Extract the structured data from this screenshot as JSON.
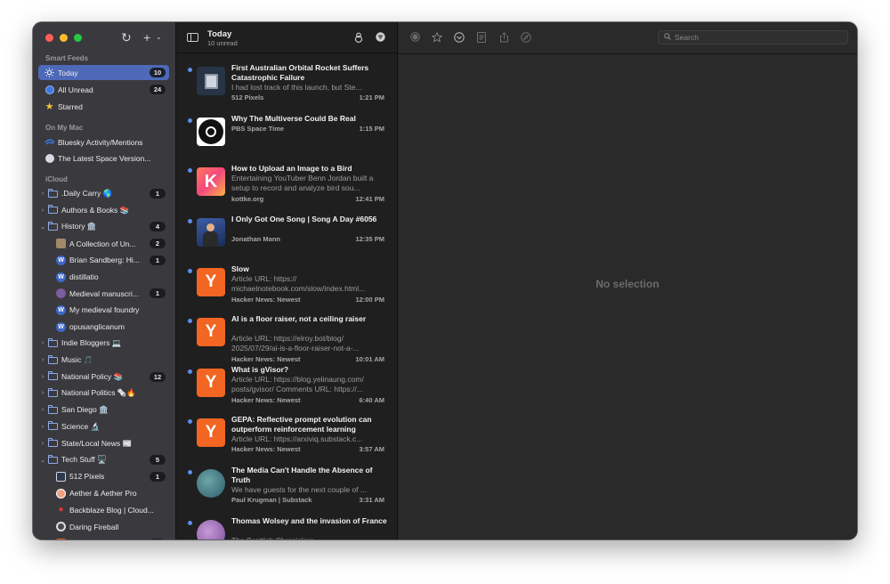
{
  "sidebar": {
    "sections": {
      "smart_feeds": "Smart Feeds",
      "on_my_mac": "On My Mac",
      "icloud": "iCloud"
    },
    "smart_feeds": [
      {
        "label": "Today",
        "count": "10",
        "icon": "sun-icon"
      },
      {
        "label": "All Unread",
        "count": "24",
        "icon": "unread-circle-icon"
      },
      {
        "label": "Starred",
        "count": "",
        "icon": "star-icon"
      }
    ],
    "on_my_mac": [
      {
        "label": "Bluesky Activity/Mentions",
        "icon": "bluesky-icon"
      },
      {
        "label": "The Latest Space Version...",
        "icon": "space-icon"
      }
    ],
    "icloud": [
      {
        "label": ".Daily Carry 🌎",
        "count": "1",
        "type": "folder",
        "expanded": false
      },
      {
        "label": "Authors & Books 📚",
        "count": "",
        "type": "folder",
        "expanded": false
      },
      {
        "label": "History 🏛️",
        "count": "4",
        "type": "folder",
        "expanded": true
      },
      {
        "label": "A Collection of Un...",
        "count": "2",
        "type": "feed"
      },
      {
        "label": "Brian Sandberg: Hi...",
        "count": "1",
        "type": "feed"
      },
      {
        "label": "distillatio",
        "count": "",
        "type": "feed"
      },
      {
        "label": "Medieval manuscri...",
        "count": "1",
        "type": "feed"
      },
      {
        "label": "My medieval foundry",
        "count": "",
        "type": "feed"
      },
      {
        "label": "opusanglicanum",
        "count": "",
        "type": "feed"
      },
      {
        "label": "Indie Bloggers 💻",
        "count": "",
        "type": "folder",
        "expanded": false
      },
      {
        "label": "Music 🎵",
        "count": "",
        "type": "folder",
        "expanded": false
      },
      {
        "label": "National Policy 📚",
        "count": "12",
        "type": "folder",
        "expanded": false
      },
      {
        "label": "National Politics 🗞️🔥",
        "count": "",
        "type": "folder",
        "expanded": false
      },
      {
        "label": "San Diego 🏛️",
        "count": "",
        "type": "folder",
        "expanded": false
      },
      {
        "label": "Science 🔬",
        "count": "",
        "type": "folder",
        "expanded": false
      },
      {
        "label": "State/Local News 📰",
        "count": "",
        "type": "folder",
        "expanded": false
      },
      {
        "label": "Tech Stuff 🖥️",
        "count": "5",
        "type": "folder",
        "expanded": true
      },
      {
        "label": "512 Pixels",
        "count": "1",
        "type": "feed"
      },
      {
        "label": "Aether & Aether Pro",
        "count": "",
        "type": "feed"
      },
      {
        "label": "Backblaze Blog | Cloud...",
        "count": "",
        "type": "feed"
      },
      {
        "label": "Daring Fireball",
        "count": "",
        "type": "feed"
      },
      {
        "label": "Hacker News: Newest",
        "count": "1",
        "type": "feed"
      }
    ]
  },
  "list": {
    "title": "Today",
    "subtitle": "10 unread",
    "articles": [
      {
        "title": "First Australian Orbital Rocket Suffers Catastrophic Failure",
        "summary": "I had lost track of this launch, but Ste...",
        "source": "512 Pixels",
        "time": "1:21 PM"
      },
      {
        "title": "Why The Multiverse Could Be Real",
        "summary": "",
        "source": "PBS Space Time",
        "time": "1:15 PM"
      },
      {
        "title": "How to Upload an Image to a Bird",
        "summary": "Entertaining YouTuber Benn Jordan built a setup to record and analyze bird sou...",
        "source": "kottke.org",
        "time": "12:41 PM"
      },
      {
        "title": "I Only Got One Song | Song A Day #6056",
        "summary": "",
        "source": "Jonathan Mann",
        "time": "12:35 PM"
      },
      {
        "title": "Slow",
        "summary": "Article URL: https:// michaelnotebook.com/slow/index.html...",
        "source": "Hacker News: Newest",
        "time": "12:00 PM"
      },
      {
        "title": "AI is a floor raiser, not a ceiling raiser",
        "summary": "Article URL: https://elroy.bot/blog/ 2025/07/29/ai-is-a-floor-raiser-not-a-...",
        "source": "Hacker News: Newest",
        "time": "10:01 AM"
      },
      {
        "title": "What is gVisor?",
        "summary": "Article URL: https://blog.yelinaung.com/ posts/gvisor/ Comments URL: https://...",
        "source": "Hacker News: Newest",
        "time": "6:40 AM"
      },
      {
        "title": "GEPA: Reflective prompt evolution can outperform reinforcement learning",
        "summary": "Article URL: https://arxiviq.substack.c...",
        "source": "Hacker News: Newest",
        "time": "3:57 AM"
      },
      {
        "title": "The Media Can't Handle the Absence of Truth",
        "summary": "We have guests for the next couple of ...",
        "source": "Paul Krugman | Substack",
        "time": "3:31 AM"
      },
      {
        "title": "Thomas Wolsey and the invasion of France",
        "summary": "The Scottish Chroniclers ...",
        "source": "",
        "time": ""
      }
    ]
  },
  "detail": {
    "search_placeholder": "Search",
    "empty_text": "No selection"
  },
  "colors": {
    "accent": "#4d69b8",
    "unread": "#5d8ee8",
    "hn_orange": "#f26522"
  }
}
